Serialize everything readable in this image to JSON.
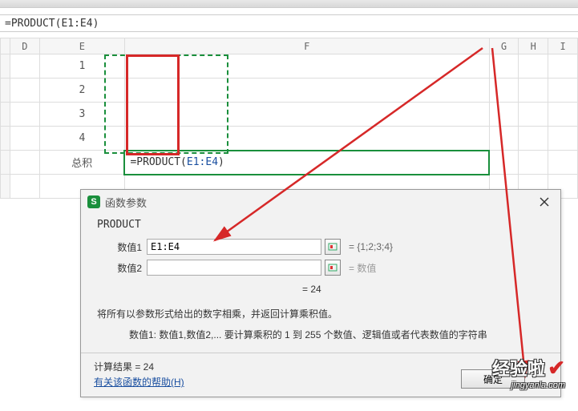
{
  "formula_bar": "=PRODUCT(E1:E4)",
  "columns": [
    "D",
    "E",
    "F",
    "G",
    "H",
    "I"
  ],
  "cells": {
    "e1": "1",
    "e2": "2",
    "e3": "3",
    "e4": "4",
    "e5": "总积",
    "f5_formula": "=PRODUCT(E1:E4)"
  },
  "dialog": {
    "title": "函数参数",
    "fn_name": "PRODUCT",
    "arg1_label": "数值1",
    "arg1_value": "E1:E4",
    "arg1_eval": "= {1;2;3;4}",
    "arg2_label": "数值2",
    "arg2_value": "",
    "arg2_placeholder": "数值",
    "arg2_eq_prefix": "= ",
    "result_line": "=  24",
    "desc_main": "将所有以参数形式给出的数字相乘，并返回计算乘积值。",
    "desc_sub": "数值1:  数值1,数值2,... 要计算乘积的 1 到 255 个数值、逻辑值或者代表数值的字符串",
    "calc_label": "计算结果 =  24",
    "help_link": "有关该函数的帮助(H)",
    "ok_button": "确定"
  },
  "watermark": {
    "line1": "经验啦",
    "line2": "jingyanla.com"
  }
}
